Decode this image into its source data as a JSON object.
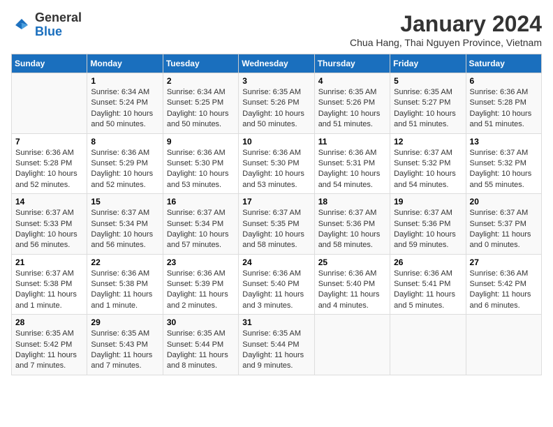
{
  "logo": {
    "general": "General",
    "blue": "Blue"
  },
  "title": "January 2024",
  "location": "Chua Hang, Thai Nguyen Province, Vietnam",
  "days_header": [
    "Sunday",
    "Monday",
    "Tuesday",
    "Wednesday",
    "Thursday",
    "Friday",
    "Saturday"
  ],
  "weeks": [
    [
      {
        "day": "",
        "content": ""
      },
      {
        "day": "1",
        "content": "Sunrise: 6:34 AM\nSunset: 5:24 PM\nDaylight: 10 hours\nand 50 minutes."
      },
      {
        "day": "2",
        "content": "Sunrise: 6:34 AM\nSunset: 5:25 PM\nDaylight: 10 hours\nand 50 minutes."
      },
      {
        "day": "3",
        "content": "Sunrise: 6:35 AM\nSunset: 5:26 PM\nDaylight: 10 hours\nand 50 minutes."
      },
      {
        "day": "4",
        "content": "Sunrise: 6:35 AM\nSunset: 5:26 PM\nDaylight: 10 hours\nand 51 minutes."
      },
      {
        "day": "5",
        "content": "Sunrise: 6:35 AM\nSunset: 5:27 PM\nDaylight: 10 hours\nand 51 minutes."
      },
      {
        "day": "6",
        "content": "Sunrise: 6:36 AM\nSunset: 5:28 PM\nDaylight: 10 hours\nand 51 minutes."
      }
    ],
    [
      {
        "day": "7",
        "content": "Sunrise: 6:36 AM\nSunset: 5:28 PM\nDaylight: 10 hours\nand 52 minutes."
      },
      {
        "day": "8",
        "content": "Sunrise: 6:36 AM\nSunset: 5:29 PM\nDaylight: 10 hours\nand 52 minutes."
      },
      {
        "day": "9",
        "content": "Sunrise: 6:36 AM\nSunset: 5:30 PM\nDaylight: 10 hours\nand 53 minutes."
      },
      {
        "day": "10",
        "content": "Sunrise: 6:36 AM\nSunset: 5:30 PM\nDaylight: 10 hours\nand 53 minutes."
      },
      {
        "day": "11",
        "content": "Sunrise: 6:36 AM\nSunset: 5:31 PM\nDaylight: 10 hours\nand 54 minutes."
      },
      {
        "day": "12",
        "content": "Sunrise: 6:37 AM\nSunset: 5:32 PM\nDaylight: 10 hours\nand 54 minutes."
      },
      {
        "day": "13",
        "content": "Sunrise: 6:37 AM\nSunset: 5:32 PM\nDaylight: 10 hours\nand 55 minutes."
      }
    ],
    [
      {
        "day": "14",
        "content": "Sunrise: 6:37 AM\nSunset: 5:33 PM\nDaylight: 10 hours\nand 56 minutes."
      },
      {
        "day": "15",
        "content": "Sunrise: 6:37 AM\nSunset: 5:34 PM\nDaylight: 10 hours\nand 56 minutes."
      },
      {
        "day": "16",
        "content": "Sunrise: 6:37 AM\nSunset: 5:34 PM\nDaylight: 10 hours\nand 57 minutes."
      },
      {
        "day": "17",
        "content": "Sunrise: 6:37 AM\nSunset: 5:35 PM\nDaylight: 10 hours\nand 58 minutes."
      },
      {
        "day": "18",
        "content": "Sunrise: 6:37 AM\nSunset: 5:36 PM\nDaylight: 10 hours\nand 58 minutes."
      },
      {
        "day": "19",
        "content": "Sunrise: 6:37 AM\nSunset: 5:36 PM\nDaylight: 10 hours\nand 59 minutes."
      },
      {
        "day": "20",
        "content": "Sunrise: 6:37 AM\nSunset: 5:37 PM\nDaylight: 11 hours\nand 0 minutes."
      }
    ],
    [
      {
        "day": "21",
        "content": "Sunrise: 6:37 AM\nSunset: 5:38 PM\nDaylight: 11 hours\nand 1 minute."
      },
      {
        "day": "22",
        "content": "Sunrise: 6:36 AM\nSunset: 5:38 PM\nDaylight: 11 hours\nand 1 minute."
      },
      {
        "day": "23",
        "content": "Sunrise: 6:36 AM\nSunset: 5:39 PM\nDaylight: 11 hours\nand 2 minutes."
      },
      {
        "day": "24",
        "content": "Sunrise: 6:36 AM\nSunset: 5:40 PM\nDaylight: 11 hours\nand 3 minutes."
      },
      {
        "day": "25",
        "content": "Sunrise: 6:36 AM\nSunset: 5:40 PM\nDaylight: 11 hours\nand 4 minutes."
      },
      {
        "day": "26",
        "content": "Sunrise: 6:36 AM\nSunset: 5:41 PM\nDaylight: 11 hours\nand 5 minutes."
      },
      {
        "day": "27",
        "content": "Sunrise: 6:36 AM\nSunset: 5:42 PM\nDaylight: 11 hours\nand 6 minutes."
      }
    ],
    [
      {
        "day": "28",
        "content": "Sunrise: 6:35 AM\nSunset: 5:42 PM\nDaylight: 11 hours\nand 7 minutes."
      },
      {
        "day": "29",
        "content": "Sunrise: 6:35 AM\nSunset: 5:43 PM\nDaylight: 11 hours\nand 7 minutes."
      },
      {
        "day": "30",
        "content": "Sunrise: 6:35 AM\nSunset: 5:44 PM\nDaylight: 11 hours\nand 8 minutes."
      },
      {
        "day": "31",
        "content": "Sunrise: 6:35 AM\nSunset: 5:44 PM\nDaylight: 11 hours\nand 9 minutes."
      },
      {
        "day": "",
        "content": ""
      },
      {
        "day": "",
        "content": ""
      },
      {
        "day": "",
        "content": ""
      }
    ]
  ]
}
